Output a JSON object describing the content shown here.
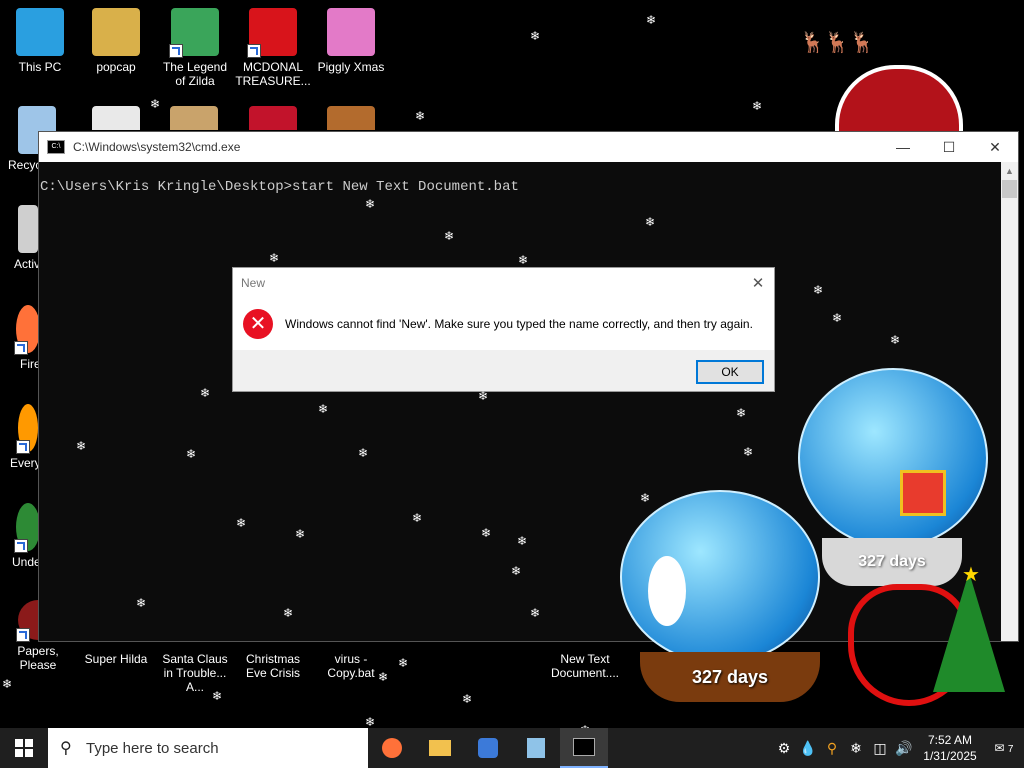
{
  "desktop_icons": [
    {
      "label": "This PC",
      "icon": "pc-icon",
      "color": "#2a9fe0"
    },
    {
      "label": "popcap",
      "icon": "folder-icon",
      "color": "#d9b04a"
    },
    {
      "label": "The Legend of Zilda",
      "icon": "game-icon",
      "color": "#3aa55a"
    },
    {
      "label": "MCDONAL TREASURE...",
      "icon": "mcdonalds-icon",
      "color": "#d8141b"
    },
    {
      "label": "Piggly Xmas",
      "icon": "pig-icon",
      "color": "#e37ac8"
    },
    {
      "label": "Recyc",
      "icon": "recycle-bin-icon",
      "color": "#9ec5e8"
    },
    {
      "label": "Activ",
      "icon": "document-icon",
      "color": "#cfcfcf"
    },
    {
      "label": "Fire",
      "icon": "firefox-icon",
      "color": "#ff7139"
    },
    {
      "label": "Every",
      "icon": "app-icon",
      "color": "#ff9900"
    },
    {
      "label": "Unde",
      "icon": "game-icon",
      "color": "#2d8a35"
    },
    {
      "label": "Papers, Please",
      "icon": "game-icon",
      "color": "#8b1a1a"
    },
    {
      "label": "Super Hilda",
      "icon": "game-icon",
      "color": "#c23b22"
    },
    {
      "label": "Santa Claus in Trouble... A...",
      "icon": "game-icon",
      "color": "#7a3b22"
    },
    {
      "label": "Christmas Eve Crisis",
      "icon": "game-icon",
      "color": "#c33"
    },
    {
      "label": "virus - Copy.bat",
      "icon": "batch-file-icon",
      "color": "#bbbbbb"
    },
    {
      "label": "New Text Document....",
      "icon": "batch-file-icon",
      "color": "#bbbbbb"
    }
  ],
  "cmd": {
    "title": "C:\\Windows\\system32\\cmd.exe",
    "line1": "C:\\Users\\Kris Kringle\\Desktop>start New Text Document.bat"
  },
  "dialog": {
    "title": "New",
    "message": "Windows cannot find 'New'. Make sure you typed the name correctly, and then try again.",
    "ok_label": "OK"
  },
  "globes": {
    "small_days": "327 days",
    "large_days": "327 days"
  },
  "taskbar": {
    "search_placeholder": "Type here to search",
    "time": "7:52 AM",
    "date": "1/31/2025",
    "notification_count": "7"
  }
}
